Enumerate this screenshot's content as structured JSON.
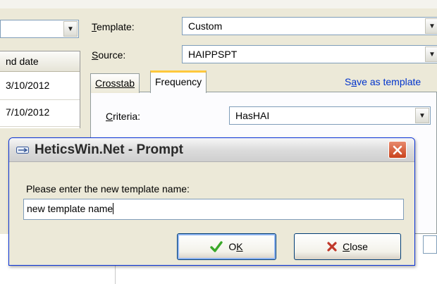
{
  "background": {
    "left_combo_value": "",
    "left_grid": {
      "column_header": "nd date",
      "rows": [
        "3/10/2012",
        "7/10/2012"
      ]
    },
    "template": {
      "label_prefix": "",
      "label_accel": "T",
      "label_rest": "emplate:",
      "value": "Custom"
    },
    "source": {
      "label_accel": "S",
      "label_rest": "ource:",
      "value": "HAIPPSPT"
    },
    "tabs": [
      {
        "label": "Crosstab"
      },
      {
        "label": "Frequency"
      }
    ],
    "save_link": {
      "before": "S",
      "accel": "a",
      "after": "ve as template"
    },
    "criteria": {
      "label_accel": "C",
      "label_rest": "riteria:",
      "value": "HasHAI"
    }
  },
  "dialog": {
    "title": "HeticsWin.Net - Prompt",
    "prompt": "Please enter the new template name:",
    "input_value": "new template name",
    "ok_label": {
      "before": "O",
      "accel": "K",
      "after": ""
    },
    "close_label": {
      "accel": "C",
      "after": "lose"
    }
  },
  "colors": {
    "dialog_border": "#0831d9",
    "link": "#0033cc",
    "ok_check": "#3aa829",
    "close_x": "#c0392b",
    "active_tab_accent": "#ffc83c"
  },
  "icons": [
    "chevron-down-icon",
    "app-icon",
    "close-icon",
    "check-icon",
    "x-icon"
  ]
}
